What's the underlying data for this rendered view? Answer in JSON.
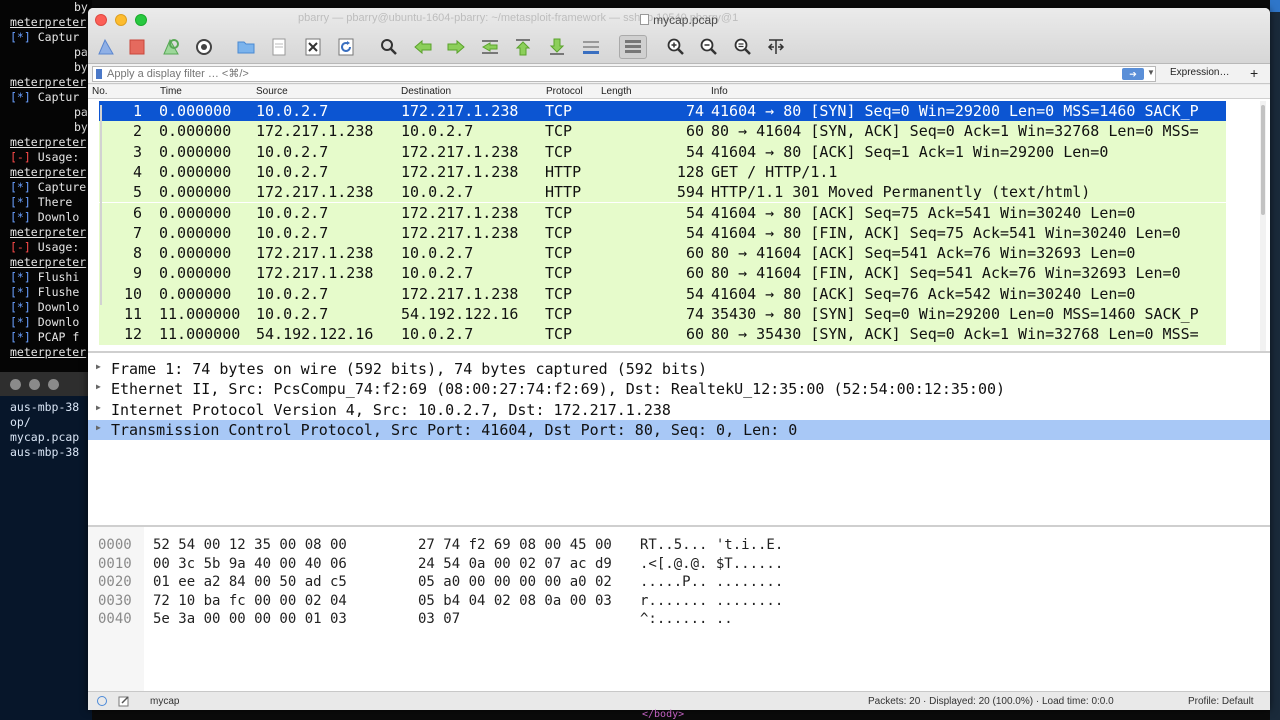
{
  "terminal_top": [
    {
      "kind": "cont",
      "text": "by"
    },
    {
      "kind": "prompt",
      "text": "meterpreter"
    },
    {
      "kind": "info",
      "tag": "[*]",
      "text": "Captur"
    },
    {
      "kind": "cont",
      "text": "pa"
    },
    {
      "kind": "cont",
      "text": "by"
    },
    {
      "kind": "prompt",
      "text": "meterpreter"
    },
    {
      "kind": "info",
      "tag": "[*]",
      "text": "Captur"
    },
    {
      "kind": "cont",
      "text": "pa"
    },
    {
      "kind": "cont",
      "text": "by"
    },
    {
      "kind": "prompt",
      "text": "meterpreter"
    },
    {
      "kind": "err",
      "tag": "[-]",
      "text": "Usage:"
    },
    {
      "kind": "prompt",
      "text": "meterpreter"
    },
    {
      "kind": "info",
      "tag": "[*]",
      "text": "Capture"
    },
    {
      "kind": "info",
      "tag": "[*]",
      "text": "There"
    },
    {
      "kind": "info",
      "tag": "[*]",
      "text": "Downlo"
    },
    {
      "kind": "prompt",
      "text": "meterpreter"
    },
    {
      "kind": "err",
      "tag": "[-]",
      "text": "Usage:"
    },
    {
      "kind": "prompt",
      "text": "meterpreter"
    },
    {
      "kind": "info",
      "tag": "[*]",
      "text": "Flushi"
    },
    {
      "kind": "info",
      "tag": "[*]",
      "text": "Flushe"
    },
    {
      "kind": "info",
      "tag": "[*]",
      "text": "Downlo"
    },
    {
      "kind": "info",
      "tag": "[*]",
      "text": "Downlo"
    },
    {
      "kind": "info",
      "tag": "[*]",
      "text": "PCAP f"
    },
    {
      "kind": "prompt",
      "text": "meterpreter"
    }
  ],
  "terminal_bottom": [
    "aus-mbp-38",
    "op/",
    "mycap.pcap",
    "aus-mbp-38"
  ],
  "window": {
    "title_bg": "pbarry — pbarry@ubuntu-1604-pbarry: ~/metasploit-framework — ssh -p 10540 pbarry@127.0.0.1 — 141×24",
    "title": "mycap.pcap"
  },
  "toolbar_icons": [
    "shark-fin-start-icon",
    "stop-capture-icon",
    "restart-capture-icon",
    "capture-options-icon",
    "open-folder-icon",
    "file-icon",
    "close-file-icon",
    "reload-icon",
    "find-packet-icon",
    "go-back-icon",
    "go-forward-icon",
    "go-to-packet-icon",
    "go-first-icon",
    "go-last-icon",
    "autoscroll-icon",
    "colorize-icon",
    "zoom-in-icon",
    "zoom-out-icon",
    "zoom-reset-icon",
    "resize-columns-icon"
  ],
  "filter": {
    "placeholder": "Apply a display filter … <⌘/>",
    "expression_label": "Expression…",
    "add_label": "+"
  },
  "packet_list": {
    "columns": [
      "No.",
      "Time",
      "Source",
      "Destination",
      "Protocol",
      "Length",
      "Info"
    ],
    "rows": [
      {
        "no": "1",
        "time": "0.000000",
        "src": "10.0.2.7",
        "dst": "172.217.1.238",
        "proto": "TCP",
        "len": "74",
        "info": "41604 → 80 [SYN] Seq=0 Win=29200 Len=0 MSS=1460 SACK_P"
      },
      {
        "no": "2",
        "time": "0.000000",
        "src": "172.217.1.238",
        "dst": "10.0.2.7",
        "proto": "TCP",
        "len": "60",
        "info": "80 → 41604 [SYN, ACK] Seq=0 Ack=1 Win=32768 Len=0 MSS="
      },
      {
        "no": "3",
        "time": "0.000000",
        "src": "10.0.2.7",
        "dst": "172.217.1.238",
        "proto": "TCP",
        "len": "54",
        "info": "41604 → 80 [ACK] Seq=1 Ack=1 Win=29200 Len=0"
      },
      {
        "no": "4",
        "time": "0.000000",
        "src": "10.0.2.7",
        "dst": "172.217.1.238",
        "proto": "HTTP",
        "len": "128",
        "info": "GET / HTTP/1.1"
      },
      {
        "no": "5",
        "time": "0.000000",
        "src": "172.217.1.238",
        "dst": "10.0.2.7",
        "proto": "HTTP",
        "len": "594",
        "info": "HTTP/1.1 301 Moved Permanently  (text/html)"
      },
      {
        "no": "6",
        "time": "0.000000",
        "src": "10.0.2.7",
        "dst": "172.217.1.238",
        "proto": "TCP",
        "len": "54",
        "info": "41604 → 80 [ACK] Seq=75 Ack=541 Win=30240 Len=0"
      },
      {
        "no": "7",
        "time": "0.000000",
        "src": "10.0.2.7",
        "dst": "172.217.1.238",
        "proto": "TCP",
        "len": "54",
        "info": "41604 → 80 [FIN, ACK] Seq=75 Ack=541 Win=30240 Len=0"
      },
      {
        "no": "8",
        "time": "0.000000",
        "src": "172.217.1.238",
        "dst": "10.0.2.7",
        "proto": "TCP",
        "len": "60",
        "info": "80 → 41604 [ACK] Seq=541 Ack=76 Win=32693 Len=0"
      },
      {
        "no": "9",
        "time": "0.000000",
        "src": "172.217.1.238",
        "dst": "10.0.2.7",
        "proto": "TCP",
        "len": "60",
        "info": "80 → 41604 [FIN, ACK] Seq=541 Ack=76 Win=32693 Len=0"
      },
      {
        "no": "10",
        "time": "0.000000",
        "src": "10.0.2.7",
        "dst": "172.217.1.238",
        "proto": "TCP",
        "len": "54",
        "info": "41604 → 80 [ACK] Seq=76 Ack=542 Win=30240 Len=0"
      },
      {
        "no": "11",
        "time": "11.000000",
        "src": "10.0.2.7",
        "dst": "54.192.122.16",
        "proto": "TCP",
        "len": "74",
        "info": "35430 → 80 [SYN] Seq=0 Win=29200 Len=0 MSS=1460 SACK_P"
      },
      {
        "no": "12",
        "time": "11.000000",
        "src": "54.192.122.16",
        "dst": "10.0.2.7",
        "proto": "TCP",
        "len": "60",
        "info": "80 → 35430 [SYN, ACK] Seq=0 Ack=1 Win=32768 Len=0 MSS="
      }
    ]
  },
  "details": [
    "Frame 1: 74 bytes on wire (592 bits), 74 bytes captured (592 bits)",
    "Ethernet II, Src: PcsCompu_74:f2:69 (08:00:27:74:f2:69), Dst: RealtekU_12:35:00 (52:54:00:12:35:00)",
    "Internet Protocol Version 4, Src: 10.0.2.7, Dst: 172.217.1.238",
    "Transmission Control Protocol, Src Port: 41604, Dst Port: 80, Seq: 0, Len: 0"
  ],
  "bytes": [
    {
      "off": "0000",
      "hex1": "52 54 00 12 35 00 08 00",
      "hex2": "27 74 f2 69 08 00 45 00",
      "ascii": "RT..5... 't.i..E."
    },
    {
      "off": "0010",
      "hex1": "00 3c 5b 9a 40 00 40 06",
      "hex2": "24 54 0a 00 02 07 ac d9",
      "ascii": ".<[.@.@. $T......"
    },
    {
      "off": "0020",
      "hex1": "01 ee a2 84 00 50 ad c5",
      "hex2": "05 a0 00 00 00 00 a0 02",
      "ascii": ".....P.. ........"
    },
    {
      "off": "0030",
      "hex1": "72 10 ba fc 00 00 02 04",
      "hex2": "05 b4 04 02 08 0a 00 03",
      "ascii": "r....... ........"
    },
    {
      "off": "0040",
      "hex1": "5e 3a 00 00 00 00 01 03",
      "hex2": "03 07",
      "ascii": "^:...... .."
    }
  ],
  "status": {
    "file": "mycap",
    "packets": "Packets: 20 · Displayed: 20 (100.0%) · Load time: 0:0.0",
    "profile": "Profile: Default"
  },
  "body_tag": "</body>",
  "colors": {
    "selected_row": "#0c55d2",
    "row_green": "#e6fbcb",
    "selected_detail": "#a8c8f6"
  }
}
